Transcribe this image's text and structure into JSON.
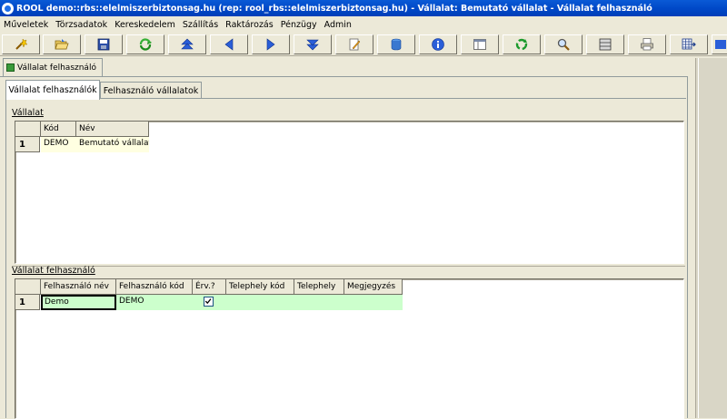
{
  "title": "ROOL demo::rbs::elelmiszerbiztonsag.hu (rep: rool_rbs::elelmiszerbiztonsag.hu) - Vállalat: Bemutató vállalat - Vállalat felhasználó",
  "menu": [
    "Műveletek",
    "Törzsadatok",
    "Kereskedelem",
    "Szállítás",
    "Raktározás",
    "Pénzügy",
    "Admin"
  ],
  "toolbar_icons": [
    "wand-icon",
    "folder-open-icon",
    "save-icon",
    "refresh-green-icon",
    "first-record-icon",
    "previous-icon",
    "next-icon",
    "last-record-icon",
    "edit-icon",
    "database-icon",
    "info-icon",
    "layout-icon",
    "recycle-icon",
    "search-icon",
    "columns-icon",
    "print-icon",
    "table-arrow-icon"
  ],
  "outer_tab": {
    "label": "Vállalat felhasználó"
  },
  "inner_tabs": [
    {
      "label": "Vállalat felhasználók",
      "active": true
    },
    {
      "label": "Felhasználó vállalatok",
      "active": false
    }
  ],
  "company_section": {
    "label": "Vállalat",
    "columns": [
      "Kód",
      "Név"
    ],
    "rows": [
      {
        "index": "1",
        "kod": "DEMO",
        "nev": "Bemutató vállalat"
      }
    ]
  },
  "user_section": {
    "label": "Vállalat felhasználó",
    "columns": [
      "Felhasználó név",
      "Felhasználó kód",
      "Érv.?",
      "Telephely kód",
      "Telephely",
      "Megjegyzés"
    ],
    "rows": [
      {
        "index": "1",
        "nev": "Demo",
        "kod": "DEMO",
        "erv": true,
        "telephely_kod": "",
        "telephely": "",
        "megjegyzes": ""
      }
    ]
  }
}
